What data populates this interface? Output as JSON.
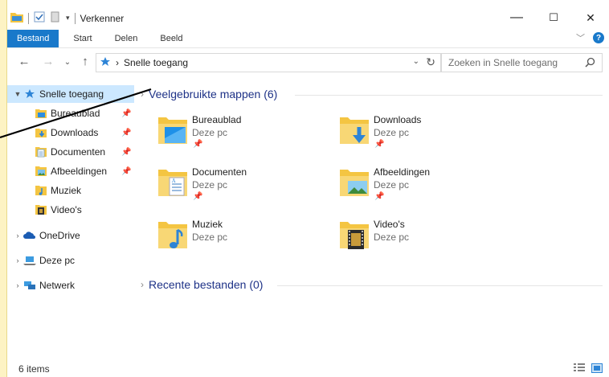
{
  "window": {
    "title": "Verkenner",
    "controls": {
      "minimize": "—",
      "maximize": "☐",
      "close": "✕"
    }
  },
  "ribbon": {
    "tabs": [
      "Bestand",
      "Start",
      "Delen",
      "Beeld"
    ],
    "help": "?"
  },
  "address": {
    "path_separator": "›",
    "path": "Snelle toegang",
    "search_placeholder": "Zoeken in Snelle toegang"
  },
  "navpane": {
    "quick_access": "Snelle toegang",
    "pinned": [
      "Bureaublad",
      "Downloads",
      "Documenten",
      "Afbeeldingen"
    ],
    "unpinned": [
      "Muziek",
      "Video's"
    ],
    "onedrive": "OneDrive",
    "this_pc": "Deze pc",
    "network": "Netwerk"
  },
  "content": {
    "frequent_header": "Veelgebruikte mappen (6)",
    "recent_header": "Recente bestanden (0)",
    "folders": [
      {
        "name": "Bureaublad",
        "location": "Deze pc",
        "pinned": true
      },
      {
        "name": "Downloads",
        "location": "Deze pc",
        "pinned": true
      },
      {
        "name": "Documenten",
        "location": "Deze pc",
        "pinned": true
      },
      {
        "name": "Afbeeldingen",
        "location": "Deze pc",
        "pinned": true
      },
      {
        "name": "Muziek",
        "location": "Deze pc",
        "pinned": false
      },
      {
        "name": "Video's",
        "location": "Deze pc",
        "pinned": false
      }
    ]
  },
  "status": {
    "items": "6 items"
  },
  "colors": {
    "accent": "#1979ca",
    "selection": "#cce8ff",
    "folder": "#f4c542",
    "heading": "#1e3287"
  }
}
